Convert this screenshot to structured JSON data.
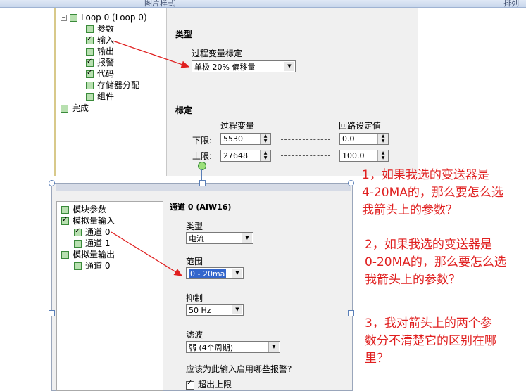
{
  "ribbon": {
    "tab_left": "图片样式",
    "tab_right": "排列"
  },
  "top": {
    "tree": {
      "root": "Loop 0 (Loop 0)",
      "items": [
        {
          "label": "参数",
          "checked": false
        },
        {
          "label": "输入",
          "checked": true
        },
        {
          "label": "输出",
          "checked": false
        },
        {
          "label": "报警",
          "checked": true
        },
        {
          "label": "代码",
          "checked": true
        },
        {
          "label": "存储器分配",
          "checked": false
        },
        {
          "label": "组件",
          "checked": false
        }
      ],
      "done": "完成"
    },
    "type_header": "类型",
    "pv_scale_label": "过程变量标定",
    "pv_scale_value": "单极 20% 偏移量",
    "scale_header": "标定",
    "pv_col": "过程变量",
    "loop_col": "回路设定值",
    "low_label": "下限:",
    "high_label": "上限:",
    "pv_low": "5530",
    "pv_high": "27648",
    "sp_low": "0.0",
    "sp_high": "100.0"
  },
  "bottom": {
    "title": "通道 0 (AIW16)",
    "tree": [
      {
        "label": "模块参数",
        "checked": false,
        "indent": 0
      },
      {
        "label": "模拟量输入",
        "checked": true,
        "indent": 0
      },
      {
        "label": "通道 0",
        "checked": true,
        "indent": 1
      },
      {
        "label": "通道 1",
        "checked": false,
        "indent": 1
      },
      {
        "label": "模拟量输出",
        "checked": false,
        "indent": 0
      },
      {
        "label": "通道 0",
        "checked": false,
        "indent": 1
      }
    ],
    "type_label": "类型",
    "type_value": "电流",
    "range_label": "范围",
    "range_value": "0 - 20ma",
    "suppress_label": "抑制",
    "suppress_value": "50 Hz",
    "filter_label": "滤波",
    "filter_value": "弱 (4个周期)",
    "alarm_question": "应该为此输入启用哪些报警?",
    "alarm_upper": "超出上限"
  },
  "questions": [
    {
      "lines": [
        "1，如果我选的变送器是",
        "4-20MA的，那么要怎么选",
        "我箭头上的参数？"
      ]
    },
    {
      "lines": [
        "2，如果我选的变送器是",
        "0-20MA的，那么要怎么选",
        "我箭头上的参数？"
      ]
    },
    {
      "lines": [
        "3，我对箭头上的两个参",
        "数分不清楚它的区别在哪",
        "里？"
      ]
    }
  ],
  "colors": {
    "annotation": "#e02020",
    "arrow": "#e02020",
    "highlight": "#3366cc"
  }
}
